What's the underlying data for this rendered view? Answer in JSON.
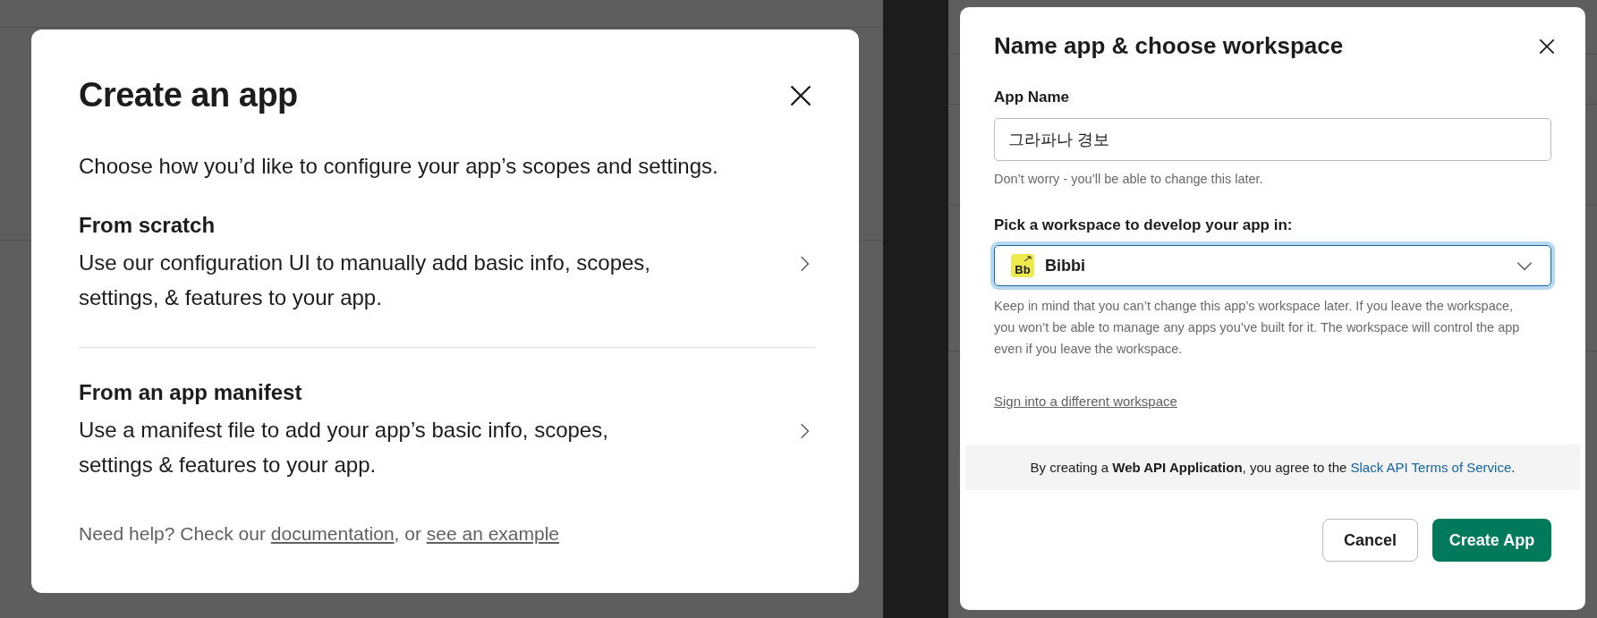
{
  "left_screen": {
    "dialog": {
      "title": "Create an app",
      "intro": "Choose how you’d like to configure your app’s scopes and settings.",
      "options": [
        {
          "title": "From scratch",
          "description": "Use our configuration UI to manually add basic info, scopes, settings, & features to your app."
        },
        {
          "title": "From an app manifest",
          "description": "Use a manifest file to add your app’s basic info, scopes, settings & features to your app."
        }
      ],
      "help": [
        {
          "kind": "text",
          "text": "Need help? Check our "
        },
        {
          "kind": "link",
          "text": "documentation"
        },
        {
          "kind": "text",
          "text": ", or "
        },
        {
          "kind": "link",
          "text": "see an example"
        }
      ]
    }
  },
  "right_screen": {
    "dialog": {
      "title": "Name app & choose workspace",
      "app_name": {
        "label": "App Name",
        "value": "그라파나 경보",
        "hint": "Don’t worry - you’ll be able to change this later."
      },
      "workspace": {
        "label": "Pick a workspace to develop your app in:",
        "icon_text": "Bb",
        "value": "Bibbi",
        "focused": true,
        "hint": "Keep in mind that you can’t change this app’s workspace later. If you leave the workspace, you won’t be able to manage any apps you’ve built for it. The workspace will control the app even if you leave the workspace."
      },
      "sign_in_link": "Sign into a different workspace",
      "terms": {
        "text": "By creating a **Web API Application**, you agree to the ",
        "link": "Slack API Terms of Service",
        "end": "."
      },
      "buttons": [
        {
          "label": "Cancel",
          "kind": "secondary"
        },
        {
          "label": "Create App",
          "kind": "primary"
        }
      ]
    }
  }
}
